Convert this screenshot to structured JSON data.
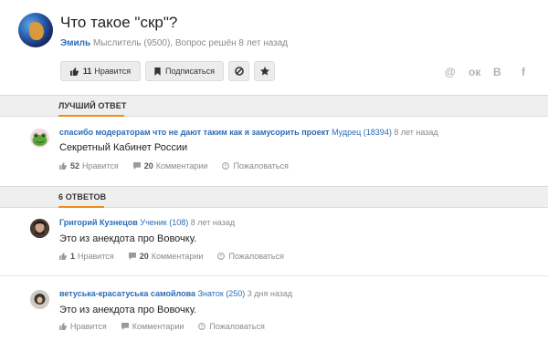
{
  "question": {
    "title": "Что такое \"скр\"?",
    "author": "Эмиль",
    "meta": "Мыслитель (9500), Вопрос решён 8 лет назад"
  },
  "toolbar": {
    "like_count": "11",
    "like_label": "Нравится",
    "subscribe_label": "Подписаться"
  },
  "share": [
    "@",
    "ок",
    "В",
    "f"
  ],
  "best_answer": {
    "section_label": "ЛУЧШИЙ ОТВЕТ",
    "author": "спасибо модераторам что не дают таким как я замусорить проект",
    "rank": "Мудрец (18394)",
    "time": "8 лет назад",
    "text": "Секретный Кабинет России",
    "likes": "52",
    "like_label": "Нравится",
    "comments": "20",
    "comments_label": "Комментарии",
    "report_label": "Пожаловаться"
  },
  "answers_section": {
    "label": "6 ОТВЕТОВ"
  },
  "answers": [
    {
      "author": "Григорий Кузнецов",
      "rank": "Ученик (108)",
      "time": "8 лет назад",
      "text": "Это из анекдота про Вовочку.",
      "likes": "1",
      "like_label": "Нравится",
      "comments": "20",
      "comments_label": "Комментарии",
      "report_label": "Пожаловаться"
    },
    {
      "author": "ветуська-красатуська самойлова",
      "rank": "Знаток (250)",
      "time": "3 дня назад",
      "text": "Это из анекдота про Вовочку.",
      "like_label": "Нравится",
      "comments_label": "Комментарии",
      "report_label": "Пожаловаться"
    }
  ],
  "colors": {
    "accent": "#f28b1c",
    "link": "#2b6cb8"
  }
}
